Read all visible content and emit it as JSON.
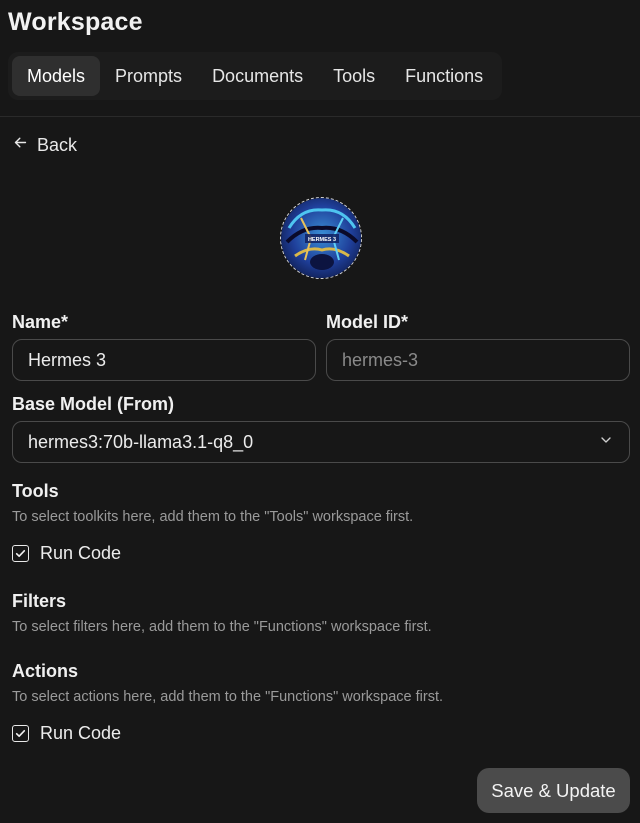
{
  "header": {
    "title": "Workspace"
  },
  "tabs": [
    {
      "label": "Models",
      "active": true
    },
    {
      "label": "Prompts",
      "active": false
    },
    {
      "label": "Documents",
      "active": false
    },
    {
      "label": "Tools",
      "active": false
    },
    {
      "label": "Functions",
      "active": false
    }
  ],
  "back": {
    "label": "Back",
    "icon": "arrow-left-icon"
  },
  "avatar": {
    "text": "HERMES 3",
    "icon": "model-avatar"
  },
  "form": {
    "name_label": "Name*",
    "name_value": "Hermes 3",
    "model_id_label": "Model ID*",
    "model_id_placeholder": "hermes-3",
    "base_model_label": "Base Model (From)",
    "base_model_value": "hermes3:70b-llama3.1-q8_0"
  },
  "tools": {
    "heading": "Tools",
    "hint": "To select toolkits here, add them to the \"Tools\" workspace first.",
    "items": [
      {
        "label": "Run Code",
        "checked": true
      }
    ]
  },
  "filters": {
    "heading": "Filters",
    "hint": "To select filters here, add them to the \"Functions\" workspace first."
  },
  "actions": {
    "heading": "Actions",
    "hint": "To select actions here, add them to the \"Functions\" workspace first.",
    "items": [
      {
        "label": "Run Code",
        "checked": true
      }
    ]
  },
  "footer": {
    "save_label": "Save & Update"
  },
  "colors": {
    "background": "#171717",
    "border": "#4a4a4a",
    "active_tab": "#2f2f2f",
    "button": "#4b4b4b",
    "hint_text": "#9a9a9a"
  }
}
